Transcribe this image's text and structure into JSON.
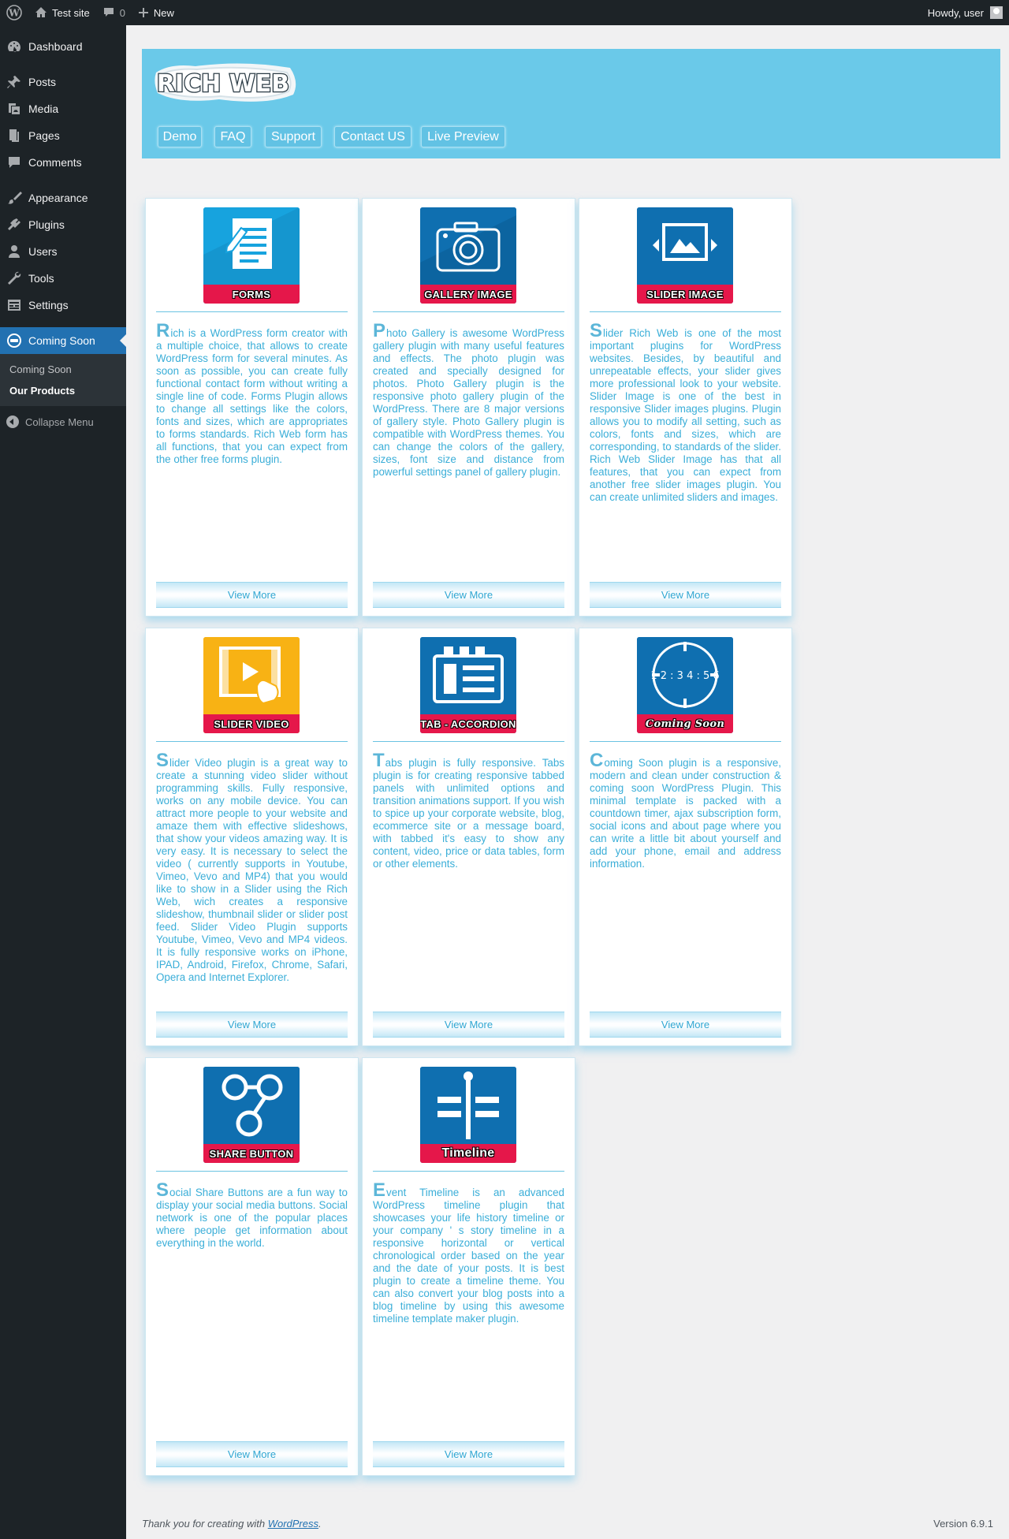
{
  "adminbar": {
    "site_name": "Test site",
    "comments_count": "0",
    "new_label": "New",
    "howdy": "Howdy, user"
  },
  "sidebar": {
    "items": [
      {
        "label": "Dashboard",
        "icon": "dashboard-icon"
      },
      {
        "label": "Posts",
        "icon": "pin-icon"
      },
      {
        "label": "Media",
        "icon": "media-icon"
      },
      {
        "label": "Pages",
        "icon": "pages-icon"
      },
      {
        "label": "Comments",
        "icon": "comments-icon"
      },
      {
        "label": "Appearance",
        "icon": "brush-icon"
      },
      {
        "label": "Plugins",
        "icon": "plug-icon"
      },
      {
        "label": "Users",
        "icon": "user-icon"
      },
      {
        "label": "Tools",
        "icon": "wrench-icon"
      },
      {
        "label": "Settings",
        "icon": "settings-icon"
      },
      {
        "label": "Coming Soon",
        "icon": "coming-soon-icon"
      }
    ],
    "submenu": [
      "Coming Soon",
      "Our Products"
    ],
    "collapse": "Collapse Menu"
  },
  "banner": {
    "logo_text": "RICH WEB",
    "nav": [
      "Demo",
      "FAQ",
      "Support",
      "Contact US",
      "Live Preview"
    ]
  },
  "products": [
    {
      "ribbon": "FORMS",
      "icon": "forms-icon",
      "initial": "R",
      "text": "ich is a WordPress form creator with a multiple choice, that allows to create WordPress form for several minutes. As soon as possible, you can create fully functional contact form without writing a single line of code. Forms Plugin allows to change all settings like the colors, fonts and sizes, which are appropriates to forms standards. Rich Web form has all functions, that you can expect from the other free forms plugin.",
      "button": "View More"
    },
    {
      "ribbon": "GALLERY IMAGE",
      "icon": "camera-icon",
      "initial": "P",
      "text": "hoto Gallery is awesome WordPress gallery plugin with many useful features and effects. The photo plugin was created and specially designed for photos. Photo Gallery plugin is the responsive photo gallery plugin of the WordPress. There are 8 major versions of gallery style. Photo Gallery plugin is compatible with WordPress themes. You can change the colors of the gallery, sizes, font size and distance from powerful settings panel of gallery plugin.",
      "button": "View More"
    },
    {
      "ribbon": "SLIDER IMAGE",
      "icon": "slider-image-icon",
      "initial": "S",
      "text": "lider Rich Web is one of the most important plugins for WordPress websites. Besides, by beautiful and unrepeatable effects, your slider gives more professional look to your website. Slider Image is one of the best in responsive Slider images plugins. Plugin allows you to modify all setting, such as colors, fonts and sizes, which are corresponding, to standards of the slider. Rich Web Slider Image has that all features, that you can expect from another free slider images plugin. You can create unlimited sliders and images.",
      "button": "View More"
    },
    {
      "ribbon": "SLIDER VIDEO",
      "icon": "video-icon",
      "initial": "S",
      "text": "lider Video plugin is a great way to create a stunning video slider without programming skills. Fully responsive, works on any mobile device. You can attract more people to your website and amaze them with effective slideshows, that show your videos amazing way. It is very easy. It is necessary to select the video ( currently supports in Youtube, Vimeo, Vevo and MP4) that you would like to show in a Slider using the Rich Web, wich creates a responsive slideshow, thumbnail slider or slider post feed. Slider Video Plugin supports Youtube, Vimeo, Vevo and MP4 videos. It is fully responsive works on iPhone, IPAD, Android, Firefox, Chrome, Safari, Opera and Internet Explorer.",
      "button": "View More"
    },
    {
      "ribbon": "TAB - ACCORDION",
      "icon": "tabs-icon",
      "initial": "T",
      "text": "abs plugin is fully responsive. Tabs plugin is for creating responsive tabbed panels with unlimited options and transition animations support. If you wish to spice up your corporate website, blog, ecommerce site or a message board, with tabbed it's easy to show any content, video, price or data tables, form or other elements.",
      "button": "View More"
    },
    {
      "ribbon": "Coming Soon",
      "icon": "countdown-icon",
      "initial": "C",
      "countdown": "1 2 : 3 4 : 5 6",
      "text": "oming Soon plugin is a responsive, modern and clean under construction & coming soon WordPress Plugin. This minimal template is packed with a countdown timer, ajax subscription form, social icons and about page where you can write a little bit about yourself and add your phone, email and address information.",
      "button": "View More"
    },
    {
      "ribbon": "SHARE BUTTON",
      "icon": "share-icon",
      "initial": "S",
      "text": "ocial Share Buttons are a fun way to display your social media buttons. Social network is one of the popular places where people get information about everything in the world.",
      "button": "View More"
    },
    {
      "ribbon": "Timeline",
      "icon": "timeline-icon",
      "initial": "E",
      "text": "vent Timeline is an advanced WordPress timeline plugin that showcases your life history timeline or your company ' s story timeline in a responsive horizontal or vertical chronological order based on the year and the date of your posts. It is best plugin to create a timeline theme. You can also convert your blog posts into a blog timeline by using this awesome timeline template maker plugin.",
      "button": "View More"
    }
  ],
  "footer": {
    "thanks_prefix": "Thank you for creating with ",
    "thanks_link": "WordPress",
    "thanks_suffix": ".",
    "version": "Version 6.9.1"
  },
  "colors": {
    "admin_dark": "#1d2327",
    "wp_blue": "#2271b1",
    "banner": "#6ac9e9",
    "icon_blue": "#0f6fb0",
    "ribbon_red": "#e5174a",
    "text_blue": "#3aaed8"
  }
}
